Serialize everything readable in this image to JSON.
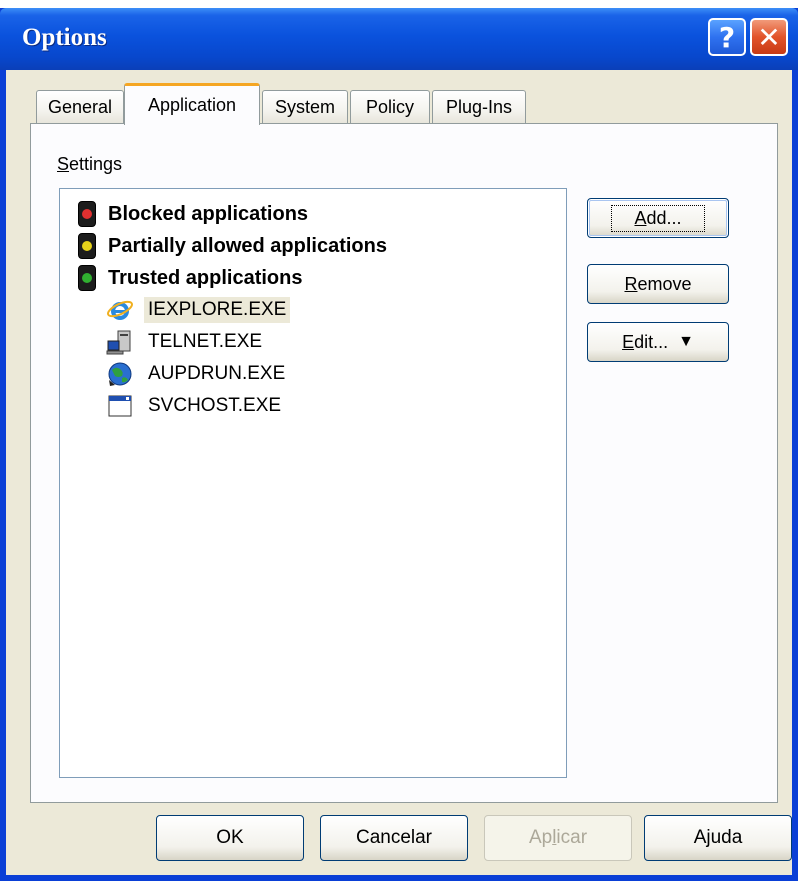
{
  "window": {
    "title": "Options"
  },
  "tabs": [
    {
      "label": "General"
    },
    {
      "label": "Application"
    },
    {
      "label": "System"
    },
    {
      "label": "Policy"
    },
    {
      "label": "Plug-Ins"
    }
  ],
  "active_tab": "Application",
  "settings": {
    "label_first": "S",
    "label_rest": "ettings"
  },
  "tree": {
    "groups": [
      {
        "label": "Blocked applications",
        "light_color": "#e03030",
        "icon": "red-traffic-light-icon"
      },
      {
        "label": "Partially allowed applications",
        "light_color": "#e6d21a",
        "icon": "yellow-traffic-light-icon"
      },
      {
        "label": "Trusted applications",
        "light_color": "#30b030",
        "icon": "green-traffic-light-icon"
      }
    ],
    "items": [
      {
        "label": "IEXPLORE.EXE",
        "icon": "internet-explorer-icon",
        "selected": true
      },
      {
        "label": "TELNET.EXE",
        "icon": "telnet-computer-icon",
        "selected": false
      },
      {
        "label": "AUPDRUN.EXE",
        "icon": "globe-update-icon",
        "selected": false
      },
      {
        "label": "SVCHOST.EXE",
        "icon": "application-window-icon",
        "selected": false
      }
    ]
  },
  "side_buttons": {
    "add": {
      "mnemonic": "A",
      "rest": "dd..."
    },
    "remove": {
      "mnemonic": "R",
      "rest": "emove"
    },
    "edit": {
      "mnemonic": "E",
      "rest": "dit...",
      "arrow": "▼"
    }
  },
  "bottom_buttons": {
    "ok": "OK",
    "cancel": "Cancelar",
    "apply_pre": "Ap",
    "apply_mnemonic": "l",
    "apply_post": "icar",
    "help": "Ajuda"
  },
  "colors": {
    "titlebar": "#0a52dd",
    "dialog_bg": "#ece9d8",
    "active_tab_accent": "#f5a623",
    "selection": "#ece9d8"
  }
}
